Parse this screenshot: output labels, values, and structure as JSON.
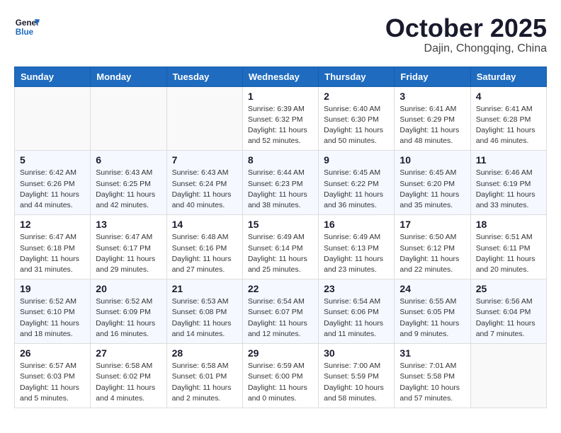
{
  "header": {
    "logo_line1": "General",
    "logo_line2": "Blue",
    "month": "October 2025",
    "location": "Dajin, Chongqing, China"
  },
  "weekdays": [
    "Sunday",
    "Monday",
    "Tuesday",
    "Wednesday",
    "Thursday",
    "Friday",
    "Saturday"
  ],
  "weeks": [
    [
      {
        "day": "",
        "info": ""
      },
      {
        "day": "",
        "info": ""
      },
      {
        "day": "",
        "info": ""
      },
      {
        "day": "1",
        "info": "Sunrise: 6:39 AM\nSunset: 6:32 PM\nDaylight: 11 hours\nand 52 minutes."
      },
      {
        "day": "2",
        "info": "Sunrise: 6:40 AM\nSunset: 6:30 PM\nDaylight: 11 hours\nand 50 minutes."
      },
      {
        "day": "3",
        "info": "Sunrise: 6:41 AM\nSunset: 6:29 PM\nDaylight: 11 hours\nand 48 minutes."
      },
      {
        "day": "4",
        "info": "Sunrise: 6:41 AM\nSunset: 6:28 PM\nDaylight: 11 hours\nand 46 minutes."
      }
    ],
    [
      {
        "day": "5",
        "info": "Sunrise: 6:42 AM\nSunset: 6:26 PM\nDaylight: 11 hours\nand 44 minutes."
      },
      {
        "day": "6",
        "info": "Sunrise: 6:43 AM\nSunset: 6:25 PM\nDaylight: 11 hours\nand 42 minutes."
      },
      {
        "day": "7",
        "info": "Sunrise: 6:43 AM\nSunset: 6:24 PM\nDaylight: 11 hours\nand 40 minutes."
      },
      {
        "day": "8",
        "info": "Sunrise: 6:44 AM\nSunset: 6:23 PM\nDaylight: 11 hours\nand 38 minutes."
      },
      {
        "day": "9",
        "info": "Sunrise: 6:45 AM\nSunset: 6:22 PM\nDaylight: 11 hours\nand 36 minutes."
      },
      {
        "day": "10",
        "info": "Sunrise: 6:45 AM\nSunset: 6:20 PM\nDaylight: 11 hours\nand 35 minutes."
      },
      {
        "day": "11",
        "info": "Sunrise: 6:46 AM\nSunset: 6:19 PM\nDaylight: 11 hours\nand 33 minutes."
      }
    ],
    [
      {
        "day": "12",
        "info": "Sunrise: 6:47 AM\nSunset: 6:18 PM\nDaylight: 11 hours\nand 31 minutes."
      },
      {
        "day": "13",
        "info": "Sunrise: 6:47 AM\nSunset: 6:17 PM\nDaylight: 11 hours\nand 29 minutes."
      },
      {
        "day": "14",
        "info": "Sunrise: 6:48 AM\nSunset: 6:16 PM\nDaylight: 11 hours\nand 27 minutes."
      },
      {
        "day": "15",
        "info": "Sunrise: 6:49 AM\nSunset: 6:14 PM\nDaylight: 11 hours\nand 25 minutes."
      },
      {
        "day": "16",
        "info": "Sunrise: 6:49 AM\nSunset: 6:13 PM\nDaylight: 11 hours\nand 23 minutes."
      },
      {
        "day": "17",
        "info": "Sunrise: 6:50 AM\nSunset: 6:12 PM\nDaylight: 11 hours\nand 22 minutes."
      },
      {
        "day": "18",
        "info": "Sunrise: 6:51 AM\nSunset: 6:11 PM\nDaylight: 11 hours\nand 20 minutes."
      }
    ],
    [
      {
        "day": "19",
        "info": "Sunrise: 6:52 AM\nSunset: 6:10 PM\nDaylight: 11 hours\nand 18 minutes."
      },
      {
        "day": "20",
        "info": "Sunrise: 6:52 AM\nSunset: 6:09 PM\nDaylight: 11 hours\nand 16 minutes."
      },
      {
        "day": "21",
        "info": "Sunrise: 6:53 AM\nSunset: 6:08 PM\nDaylight: 11 hours\nand 14 minutes."
      },
      {
        "day": "22",
        "info": "Sunrise: 6:54 AM\nSunset: 6:07 PM\nDaylight: 11 hours\nand 12 minutes."
      },
      {
        "day": "23",
        "info": "Sunrise: 6:54 AM\nSunset: 6:06 PM\nDaylight: 11 hours\nand 11 minutes."
      },
      {
        "day": "24",
        "info": "Sunrise: 6:55 AM\nSunset: 6:05 PM\nDaylight: 11 hours\nand 9 minutes."
      },
      {
        "day": "25",
        "info": "Sunrise: 6:56 AM\nSunset: 6:04 PM\nDaylight: 11 hours\nand 7 minutes."
      }
    ],
    [
      {
        "day": "26",
        "info": "Sunrise: 6:57 AM\nSunset: 6:03 PM\nDaylight: 11 hours\nand 5 minutes."
      },
      {
        "day": "27",
        "info": "Sunrise: 6:58 AM\nSunset: 6:02 PM\nDaylight: 11 hours\nand 4 minutes."
      },
      {
        "day": "28",
        "info": "Sunrise: 6:58 AM\nSunset: 6:01 PM\nDaylight: 11 hours\nand 2 minutes."
      },
      {
        "day": "29",
        "info": "Sunrise: 6:59 AM\nSunset: 6:00 PM\nDaylight: 11 hours\nand 0 minutes."
      },
      {
        "day": "30",
        "info": "Sunrise: 7:00 AM\nSunset: 5:59 PM\nDaylight: 10 hours\nand 58 minutes."
      },
      {
        "day": "31",
        "info": "Sunrise: 7:01 AM\nSunset: 5:58 PM\nDaylight: 10 hours\nand 57 minutes."
      },
      {
        "day": "",
        "info": ""
      }
    ]
  ]
}
